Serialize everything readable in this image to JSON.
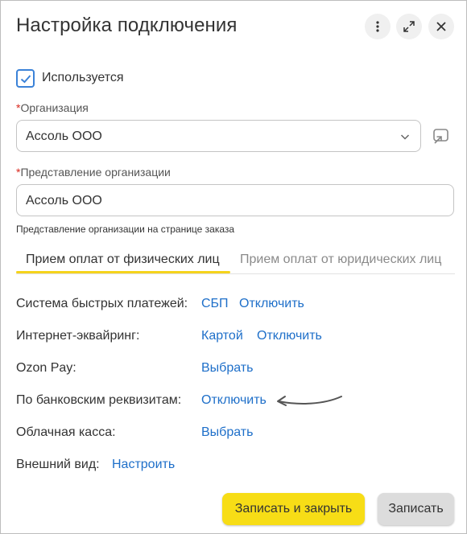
{
  "window": {
    "title": "Настройка подключения"
  },
  "header_buttons": [
    {
      "icon": "more-vertical-icon"
    },
    {
      "icon": "expand-icon"
    },
    {
      "icon": "close-icon"
    }
  ],
  "used_checkbox": {
    "label": "Используется",
    "checked": true
  },
  "organization": {
    "required_mark": "*",
    "label": "Организация",
    "value": "Ассоль ООО"
  },
  "org_representation": {
    "required_mark": "*",
    "label": "Представление организации",
    "value": "Ассоль ООО",
    "hint": "Представление организации на странице заказа"
  },
  "tabs": [
    {
      "label": "Прием оплат от физических лиц",
      "active": true
    },
    {
      "label": "Прием оплат от юридических лиц",
      "active": false
    }
  ],
  "rows": [
    {
      "label": "Система быстрых платежей:",
      "links": [
        "СБП",
        "Отключить"
      ]
    },
    {
      "label": "Интернет-эквайринг:",
      "links": [
        "Картой",
        "Отключить"
      ]
    },
    {
      "label": "Ozon Pay:",
      "links": [
        "Выбрать"
      ]
    },
    {
      "label": "По банковским реквизитам:",
      "links": [
        "Отключить"
      ]
    },
    {
      "label": "Облачная касса:",
      "links": [
        "Выбрать"
      ]
    },
    {
      "label": "Внешний вид:",
      "links": [
        "Настроить"
      ]
    }
  ],
  "footer": {
    "primary_label": "Записать и закрыть",
    "secondary_label": "Записать"
  },
  "colors": {
    "accent": "#f7dd16",
    "link": "#1e6fc9",
    "required": "#d9281e",
    "checkbox": "#3b82d8"
  }
}
